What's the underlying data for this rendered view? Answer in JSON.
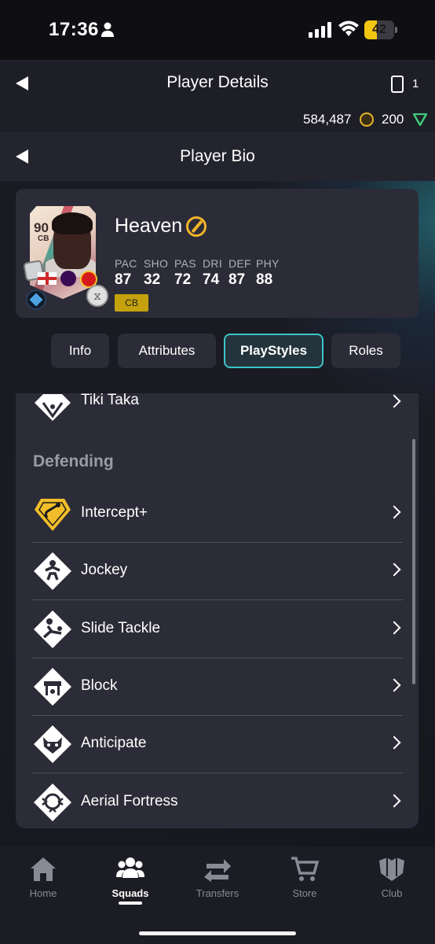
{
  "status_bar": {
    "time": "17:36",
    "battery": "42",
    "battery_fraction": 0.42
  },
  "header": {
    "title": "Player Details",
    "card_count": "1",
    "coins": "584,487",
    "points": "200"
  },
  "subheader": {
    "title": "Player Bio"
  },
  "player": {
    "rating": "90",
    "position": "CB",
    "name": "Heaven",
    "position_chip": "CB",
    "stats": [
      {
        "label": "PAC",
        "value": "87"
      },
      {
        "label": "SHO",
        "value": "32"
      },
      {
        "label": "PAS",
        "value": "72"
      },
      {
        "label": "DRI",
        "value": "74"
      },
      {
        "label": "DEF",
        "value": "87"
      },
      {
        "label": "PHY",
        "value": "88"
      }
    ]
  },
  "tabs": [
    {
      "label": "Info"
    },
    {
      "label": "Attributes"
    },
    {
      "label": "PlayStyles"
    },
    {
      "label": "Roles"
    }
  ],
  "active_tab": "PlayStyles",
  "playstyles": {
    "top_item": {
      "label": "Tiki Taka",
      "icon": "tiki-taka-icon"
    },
    "section_title": "Defending",
    "items": [
      {
        "label": "Intercept+",
        "icon": "intercept-plus-icon",
        "plus": true
      },
      {
        "label": "Jockey",
        "icon": "jockey-icon"
      },
      {
        "label": "Slide Tackle",
        "icon": "slide-tackle-icon"
      },
      {
        "label": "Block",
        "icon": "block-icon"
      },
      {
        "label": "Anticipate",
        "icon": "anticipate-icon"
      },
      {
        "label": "Aerial Fortress",
        "icon": "aerial-fortress-icon"
      }
    ]
  },
  "nav": [
    {
      "label": "Home",
      "icon": "home-icon"
    },
    {
      "label": "Squads",
      "icon": "squads-icon"
    },
    {
      "label": "Transfers",
      "icon": "transfers-icon"
    },
    {
      "label": "Store",
      "icon": "store-icon"
    },
    {
      "label": "Club",
      "icon": "club-icon"
    }
  ],
  "active_nav": "Squads",
  "colors": {
    "accent": "#3cc5c9",
    "gold": "#f0b429",
    "position_chip": "#c5a20d",
    "panel": "#2c2c38"
  }
}
